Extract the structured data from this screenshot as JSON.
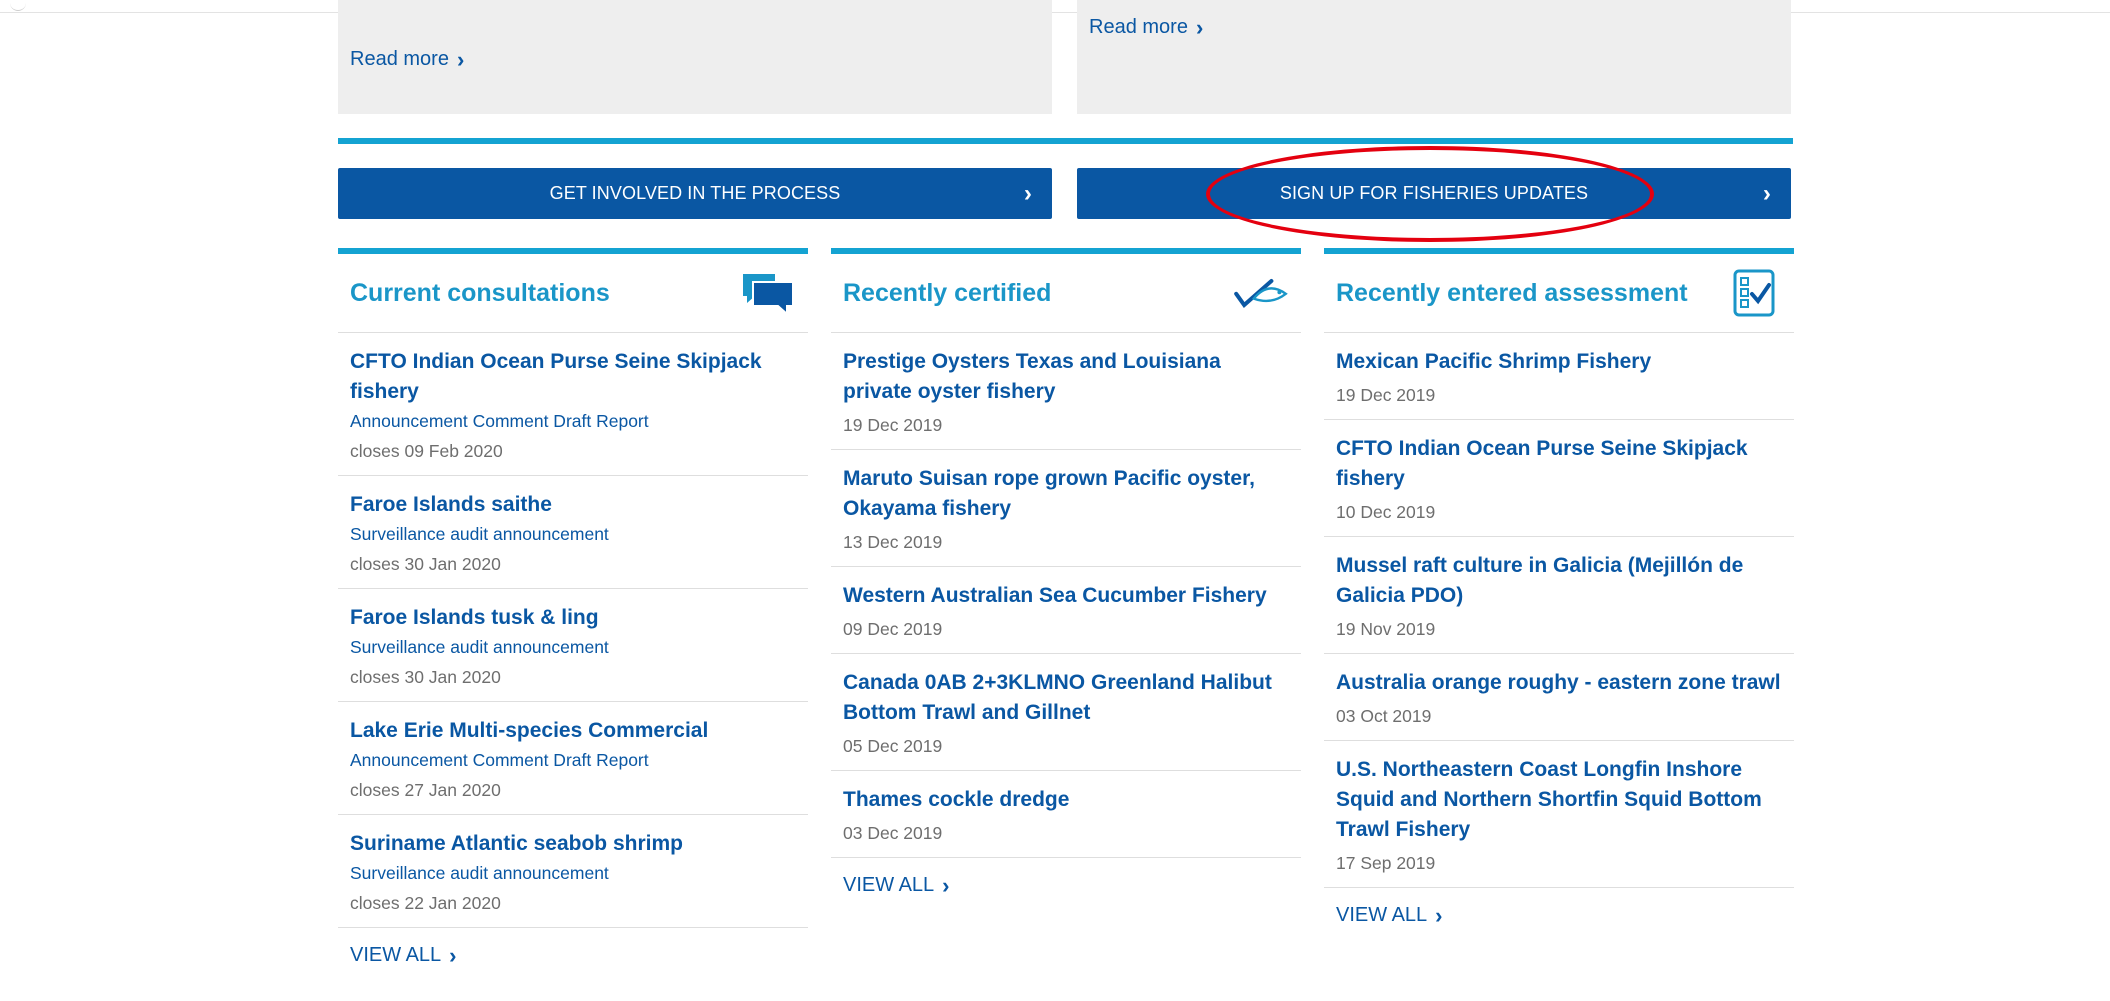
{
  "promos": {
    "left_readmore": "Read more",
    "right_readmore": "Read more"
  },
  "cta": {
    "left": "GET INVOLVED IN THE PROCESS",
    "right": "SIGN UP FOR FISHERIES UPDATES",
    "arrow": "›"
  },
  "columns": [
    {
      "title": "Current consultations",
      "icon": "chat-bubbles-icon",
      "items": [
        {
          "title": "CFTO Indian Ocean Purse Seine Skipjack fishery",
          "sub": "Announcement Comment Draft Report",
          "date": "closes 09 Feb 2020"
        },
        {
          "title": "Faroe Islands saithe",
          "sub": "Surveillance audit announcement",
          "date": "closes 30 Jan 2020"
        },
        {
          "title": "Faroe Islands tusk & ling",
          "sub": "Surveillance audit announcement",
          "date": "closes 30 Jan 2020"
        },
        {
          "title": "Lake Erie Multi-species Commercial",
          "sub": "Announcement Comment Draft Report",
          "date": "closes 27 Jan 2020"
        },
        {
          "title": "Suriname Atlantic seabob shrimp",
          "sub": "Surveillance audit announcement",
          "date": "closes 22 Jan 2020"
        }
      ],
      "view_all": "VIEW ALL"
    },
    {
      "title": "Recently certified",
      "icon": "fish-check-icon",
      "items": [
        {
          "title": "Prestige Oysters Texas and Louisiana private oyster fishery",
          "date": "19 Dec 2019"
        },
        {
          "title": "Maruto Suisan rope grown Pacific oyster, Okayama fishery",
          "date": "13 Dec 2019"
        },
        {
          "title": "Western Australian Sea Cucumber Fishery",
          "date": "09 Dec 2019"
        },
        {
          "title": "Canada 0AB 2+3KLMNO Greenland Halibut Bottom Trawl and Gillnet",
          "date": "05 Dec 2019"
        },
        {
          "title": "Thames cockle dredge",
          "date": "03 Dec 2019"
        }
      ],
      "view_all": "VIEW ALL"
    },
    {
      "title": "Recently entered assessment",
      "icon": "checklist-icon",
      "items": [
        {
          "title": "Mexican Pacific Shrimp Fishery",
          "date": "19 Dec 2019"
        },
        {
          "title": "CFTO Indian Ocean Purse Seine Skipjack fishery",
          "date": "10 Dec 2019"
        },
        {
          "title": "Mussel raft culture in Galicia (Mejillón de Galicia PDO)",
          "date": "19 Nov 2019"
        },
        {
          "title": "Australia orange roughy - eastern zone trawl",
          "date": "03 Oct 2019"
        },
        {
          "title": "U.S. Northeastern Coast Longfin Inshore Squid and Northern Shortfin Squid Bottom Trawl Fishery",
          "date": "17 Sep 2019"
        }
      ],
      "view_all": "VIEW ALL"
    }
  ],
  "colors": {
    "brand_blue": "#0a57a3",
    "accent_cyan": "#14a3d2",
    "highlight_red": "#e4000f"
  }
}
